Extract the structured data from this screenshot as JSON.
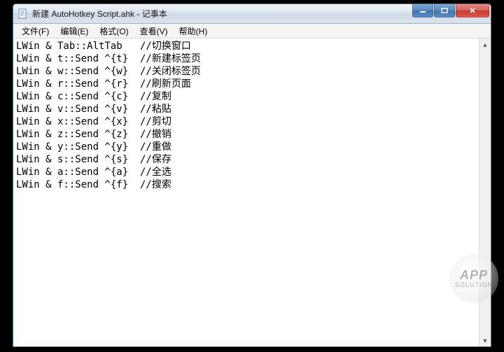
{
  "window": {
    "title": "新建 AutoHotkey Script.ahk - 记事本"
  },
  "menubar": {
    "file": "文件(F)",
    "edit": "编辑(E)",
    "format": "格式(O)",
    "view": "查看(V)",
    "help": "帮助(H)"
  },
  "content": "LWin & Tab::AltTab   //切换窗口\nLWin & t::Send ^{t}  //新建标签页\nLWin & w::Send ^{w}  //关闭标签页\nLWin & r::Send ^{r}  //刷新页面\nLWin & c::Send ^{c}  //复制\nLWin & v::Send ^{v}  //粘贴\nLWin & x::Send ^{x}  //剪切\nLWin & z::Send ^{z}  //撤销\nLWin & y::Send ^{y}  //重做\nLWin & s::Send ^{s}  //保存\nLWin & a::Send ^{a}  //全选\nLWin & f::Send ^{f}  //搜索",
  "watermark": {
    "line1": "APP",
    "line2": "SOLUTION"
  }
}
